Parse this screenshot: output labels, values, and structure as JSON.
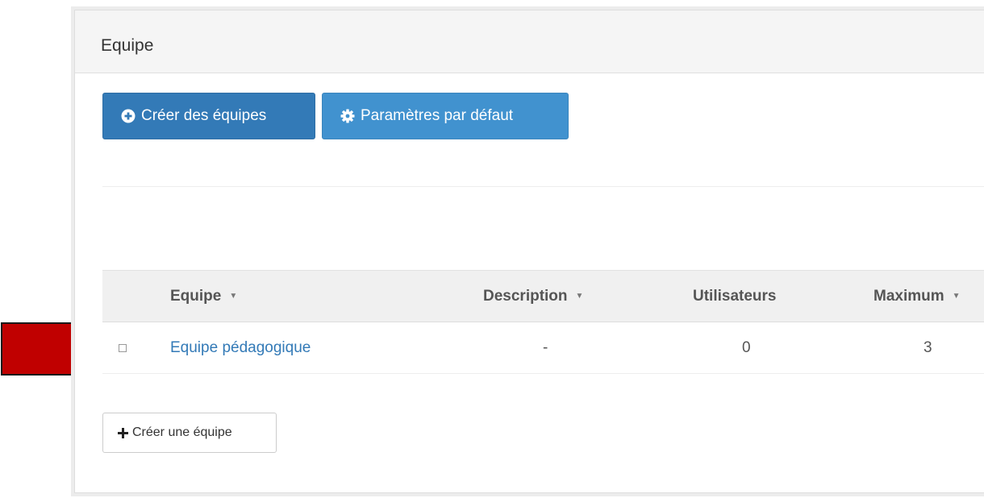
{
  "panel": {
    "title": "Equipe"
  },
  "toolbar": {
    "create_teams_label": "Créer des équipes",
    "default_settings_label": "Paramètres par défaut"
  },
  "table": {
    "columns": [
      {
        "label": "Equipe",
        "sortable": true
      },
      {
        "label": "Description",
        "sortable": true
      },
      {
        "label": "Utilisateurs",
        "sortable": false
      },
      {
        "label": "Maximum",
        "sortable": true
      }
    ],
    "rows": [
      {
        "name": "Equipe pédagogique",
        "description": "-",
        "users": "0",
        "maximum": "3",
        "checked": false
      }
    ]
  },
  "footer": {
    "create_team_label": "Créer une équipe"
  },
  "icons": {
    "create_teams": "plus-circle-icon",
    "default_settings": "gear-icon",
    "sort": "caret-down-icon",
    "create_team": "plus-icon",
    "annotation": "red-arrow"
  },
  "colors": {
    "primary": "#337ab7",
    "info": "#4192cf",
    "link": "#337ab7",
    "arrow": "#c00000"
  }
}
